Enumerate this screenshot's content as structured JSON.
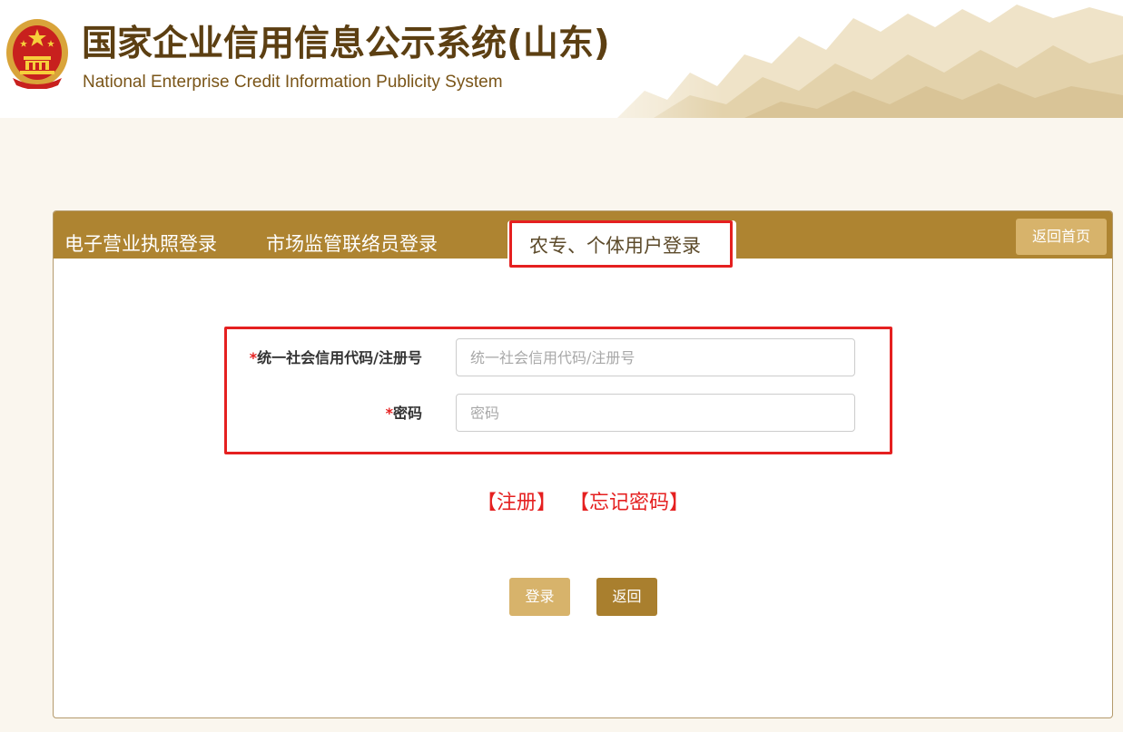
{
  "header": {
    "title": "国家企业信用信息公示系统(山东)",
    "subtitle": "National Enterprise Credit Information Publicity System"
  },
  "tabs": [
    {
      "label": "电子营业执照登录",
      "active": false
    },
    {
      "label": "市场监管联络员登录",
      "active": false
    },
    {
      "label": "农专、个体用户登录",
      "active": true
    }
  ],
  "home_button": {
    "label": "返回首页"
  },
  "form": {
    "code": {
      "required_mark": "*",
      "label": "统一社会信用代码/注册号",
      "placeholder": "统一社会信用代码/注册号",
      "value": ""
    },
    "password": {
      "required_mark": "*",
      "label": "密码",
      "placeholder": "密码",
      "value": ""
    }
  },
  "links": {
    "register": "【注册】",
    "forgot": "【忘记密码】"
  },
  "buttons": {
    "login": "登录",
    "back": "返回"
  },
  "colors": {
    "brand_gold": "#ae8431",
    "light_gold": "#d7b36b",
    "highlight_red": "#e52020",
    "title_brown": "#5c3f12",
    "page_bg": "#faf6ee"
  }
}
